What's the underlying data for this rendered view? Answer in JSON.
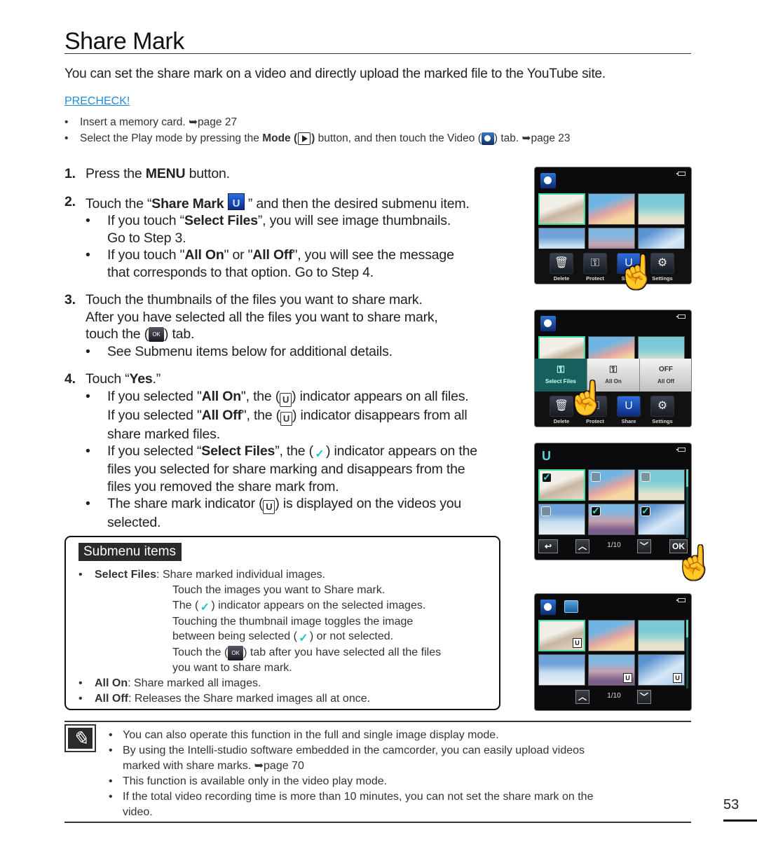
{
  "page": {
    "title": "Share Mark",
    "intro": "You can set the share mark on a video and directly upload the marked file to the YouTube site.",
    "page_number": "53"
  },
  "precheck": {
    "label": "PRECHECK!",
    "items": [
      {
        "text": "Insert a memory card.",
        "ref": "➥page 27"
      },
      {
        "pre": "Select the Play mode by pressing the ",
        "bold": "Mode (",
        "bold_after": ")",
        "mid": " button, and then touch the Video (",
        "post": ") tab.",
        "ref": "➥page 23"
      }
    ]
  },
  "steps": {
    "s1": {
      "num": "1.",
      "pre": "Press the ",
      "bold": "MENU",
      "post": " button."
    },
    "s2": {
      "num": "2.",
      "pre": "Touch the “",
      "bold": "Share Mark",
      "post": " ” and then the desired submenu item.",
      "b1_pre": "If you touch “",
      "b1_bold": "Select Files",
      "b1_post": "”, you will see image thumbnails.",
      "b1_line2": "Go to Step 3.",
      "b2_pre": "If you touch \"",
      "b2_bold1": "All On",
      "b2_mid": "\" or \"",
      "b2_bold2": "All Off",
      "b2_post": "\", you will see the message",
      "b2_line2": "that corresponds to that option. Go to Step 4."
    },
    "s3": {
      "num": "3.",
      "line1": "Touch the thumbnails of the files you want to share mark.",
      "line2": "After you have selected all the files you want to share mark,",
      "line3_pre": "touch the (",
      "line3_post": ") tab.",
      "b1": "See Submenu items below for additional details."
    },
    "s4": {
      "num": "4.",
      "pre": "Touch “",
      "bold": "Yes",
      "post": ".”",
      "b1_pre": "If you selected \"",
      "b1_bold": "All On",
      "b1_mid": "\", the (",
      "b1_post": ") indicator appears on all files.",
      "b1b_pre": "If you selected \"",
      "b1b_bold": "All Off",
      "b1b_mid": "\", the (",
      "b1b_post": ") indicator disappears from all",
      "b1b_line2": "share marked files.",
      "b2_pre": "If you selected “",
      "b2_bold": "Select Files",
      "b2_mid": "”, the (",
      "b2_post": ") indicator appears on the",
      "b2_line2": "files you selected for share marking and disappears from the",
      "b2_line3": "files you removed the share mark from.",
      "b3_pre": "The share mark indicator (",
      "b3_post": ") is displayed on the videos you",
      "b3_line2": "selected."
    }
  },
  "icons": {
    "ok": "OK",
    "share_glyph": "U",
    "check_glyph": "✓",
    "note_glyph": "✎",
    "hand_glyph": "☝"
  },
  "submenu": {
    "title": "Submenu items",
    "select_files": {
      "bold": "Select Files",
      "line1": ": Share marked individual images.",
      "line2": "Touch the images you want to Share mark.",
      "line3_pre": "The (",
      "line3_post": ") indicator appears on the selected images.",
      "line4": "Touching the thumbnail image toggles the image",
      "line5_pre": "between being selected (",
      "line5_post": ") or not selected.",
      "line6_pre": "Touch the (",
      "line6_post": ") tab after you have selected all the files",
      "line7": "you want to share mark."
    },
    "all_on": {
      "bold": "All On",
      "text": ": Share marked all images."
    },
    "all_off": {
      "bold": "All Off",
      "text": ": Releases the Share marked images all at once."
    }
  },
  "screens": {
    "menu": {
      "labels": [
        "Delete",
        "Protect",
        "Share",
        "Settings"
      ]
    },
    "popup": {
      "options": [
        "Select Files",
        "All On",
        "All Off"
      ],
      "off_glyph": "OFF"
    },
    "select": {
      "page": "1/10",
      "ok": "OK",
      "checked": [
        true,
        false,
        false,
        false,
        true,
        true
      ]
    },
    "result": {
      "page": "1/10",
      "marked": [
        true,
        false,
        false,
        false,
        true,
        true
      ]
    }
  },
  "notes": [
    "You can also operate this function in the full and single image display mode.",
    "By using the Intelli-studio software embedded in the camcorder, you can easily upload videos",
    "marked with share marks. ➥page 70",
    "This function is available only in the video play mode.",
    "If the total video recording time is more than 10 minutes, you can not set the share mark on the",
    "video."
  ]
}
